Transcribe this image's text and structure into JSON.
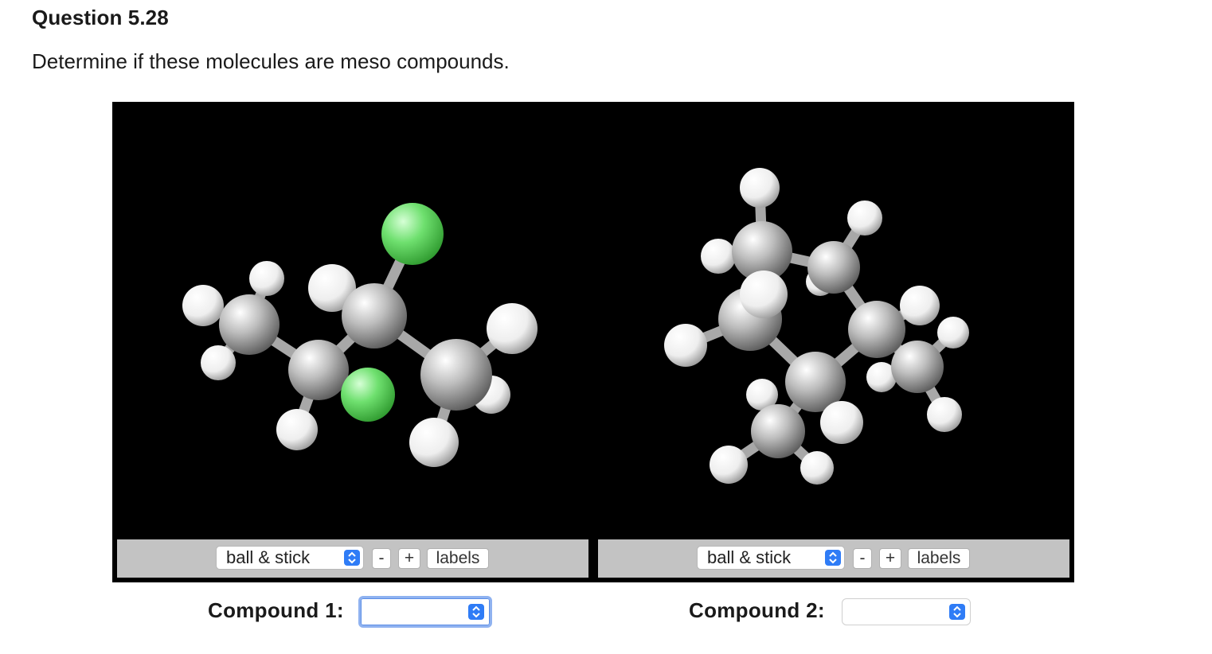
{
  "question": {
    "title": "Question 5.28",
    "prompt": "Determine if these molecules are meso compounds."
  },
  "viewers": [
    {
      "render_mode": "ball & stick",
      "zoom_out_label": "-",
      "zoom_in_label": "+",
      "labels_button": "labels"
    },
    {
      "render_mode": "ball & stick",
      "zoom_out_label": "-",
      "zoom_in_label": "+",
      "labels_button": "labels"
    }
  ],
  "answers": {
    "compound1_label": "Compound 1:",
    "compound1_value": "",
    "compound2_label": "Compound 2:",
    "compound2_value": ""
  },
  "colors": {
    "carbon": "#b4b4b4",
    "hydrogen": "#f2f2f2",
    "chlorine": "#6ee06e",
    "select_accent": "#2f7cf6",
    "viewer_background": "#000000",
    "control_bar": "#c3c3c3"
  }
}
